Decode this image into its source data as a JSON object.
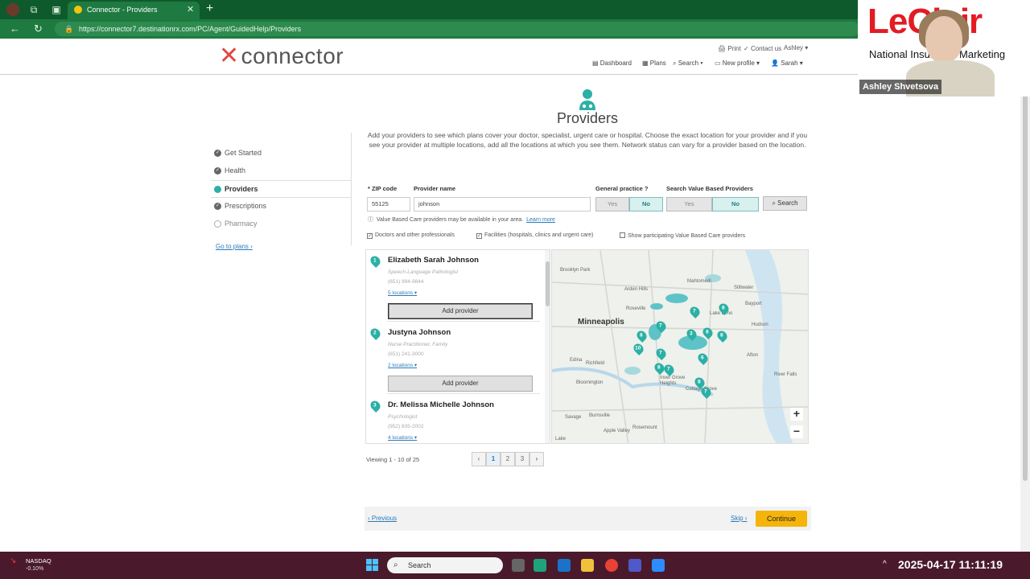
{
  "browser": {
    "tab_title": "Connector - Providers",
    "url": "https://connector7.destinationrx.com/PC/Agent/GuidedHelp/Providers"
  },
  "header": {
    "logo": "connector",
    "util": {
      "print": "Print",
      "contact": "Contact us",
      "user": "Ashley"
    },
    "nav": {
      "dashboard": "Dashboard",
      "plans": "Plans",
      "search": "Search",
      "new_profile": "New profile",
      "sarah": "Sarah"
    }
  },
  "page": {
    "title": "Providers",
    "intro": "Add your providers to see which plans cover your doctor, specialist, urgent care or hospital. Choose the exact location for your provider and if you see your provider at multiple locations, add all the locations at which you see them. Network status can vary for a provider based on the location."
  },
  "sidebar": {
    "items": [
      {
        "label": "Get Started",
        "state": "done"
      },
      {
        "label": "Health",
        "state": "done"
      },
      {
        "label": "Providers",
        "state": "active"
      },
      {
        "label": "Prescriptions",
        "state": "done"
      },
      {
        "label": "Pharmacy",
        "state": "todo"
      }
    ],
    "go_to_plans": "Go to plans"
  },
  "form": {
    "zip_label": "* ZIP code",
    "zip_value": "55125",
    "name_label": "Provider name",
    "name_value": "johnson",
    "gp_label": "General practice",
    "gp_yes": "Yes",
    "gp_no": "No",
    "vb_label": "Search Value Based Providers",
    "vb_yes": "Yes",
    "vb_no": "No",
    "search_button": "Search",
    "note_text": "Value Based Care providers may be available in your area.",
    "note_link": "Learn more",
    "check_doctors": "Doctors and other professionals",
    "check_facilities": "Facilities (hospitals, clinics and urgent care)",
    "check_vbc": "Show participating Value Based Care providers"
  },
  "results": [
    {
      "num": "1",
      "name": "Elizabeth Sarah Johnson",
      "specialty": "Speech-Language Pathologist",
      "phone": "(651) 994-9844",
      "locations": "5 locations",
      "add": "Add provider"
    },
    {
      "num": "2",
      "name": "Justyna Johnson",
      "specialty": "Nurse Practitioner, Family",
      "phone": "(651) 241-3000",
      "locations": "2 locations",
      "add": "Add provider"
    },
    {
      "num": "3",
      "name": "Dr. Melissa Michelle Johnson",
      "specialty": "Psychologist",
      "phone": "(952) 835-2002",
      "locations": "4 locations",
      "add": "Add provider"
    }
  ],
  "map": {
    "labels": [
      "Brooklyn Park",
      "Mahtomedi",
      "Stillwater",
      "Arden Hills",
      "Roseville",
      "Lake Elmo",
      "Bayport",
      "Minneapolis",
      "Hudson",
      "Edina",
      "Richfield",
      "Afton",
      "Bloomington",
      "Inver Grove Heights",
      "Cottage Grove",
      "River Falls",
      "Savage",
      "Burnsville",
      "Apple Valley",
      "Rosemount",
      "Lake"
    ],
    "zoom_in": "+",
    "zoom_out": "−"
  },
  "pagination": {
    "viewing": "Viewing 1 - 10 of 25",
    "pages": [
      "1",
      "2",
      "3"
    ]
  },
  "footer": {
    "previous": "Previous",
    "skip": "Skip",
    "continue": "Continue"
  },
  "video": {
    "logo": "LeClair",
    "subtitle": "National Insurance Marketing",
    "name": "Ashley Shvetsova"
  },
  "taskbar": {
    "ticker": "NASDAQ",
    "ticker_change": "-0.10%",
    "search": "Search",
    "datetime": "2025-04-17 11:11:19"
  }
}
